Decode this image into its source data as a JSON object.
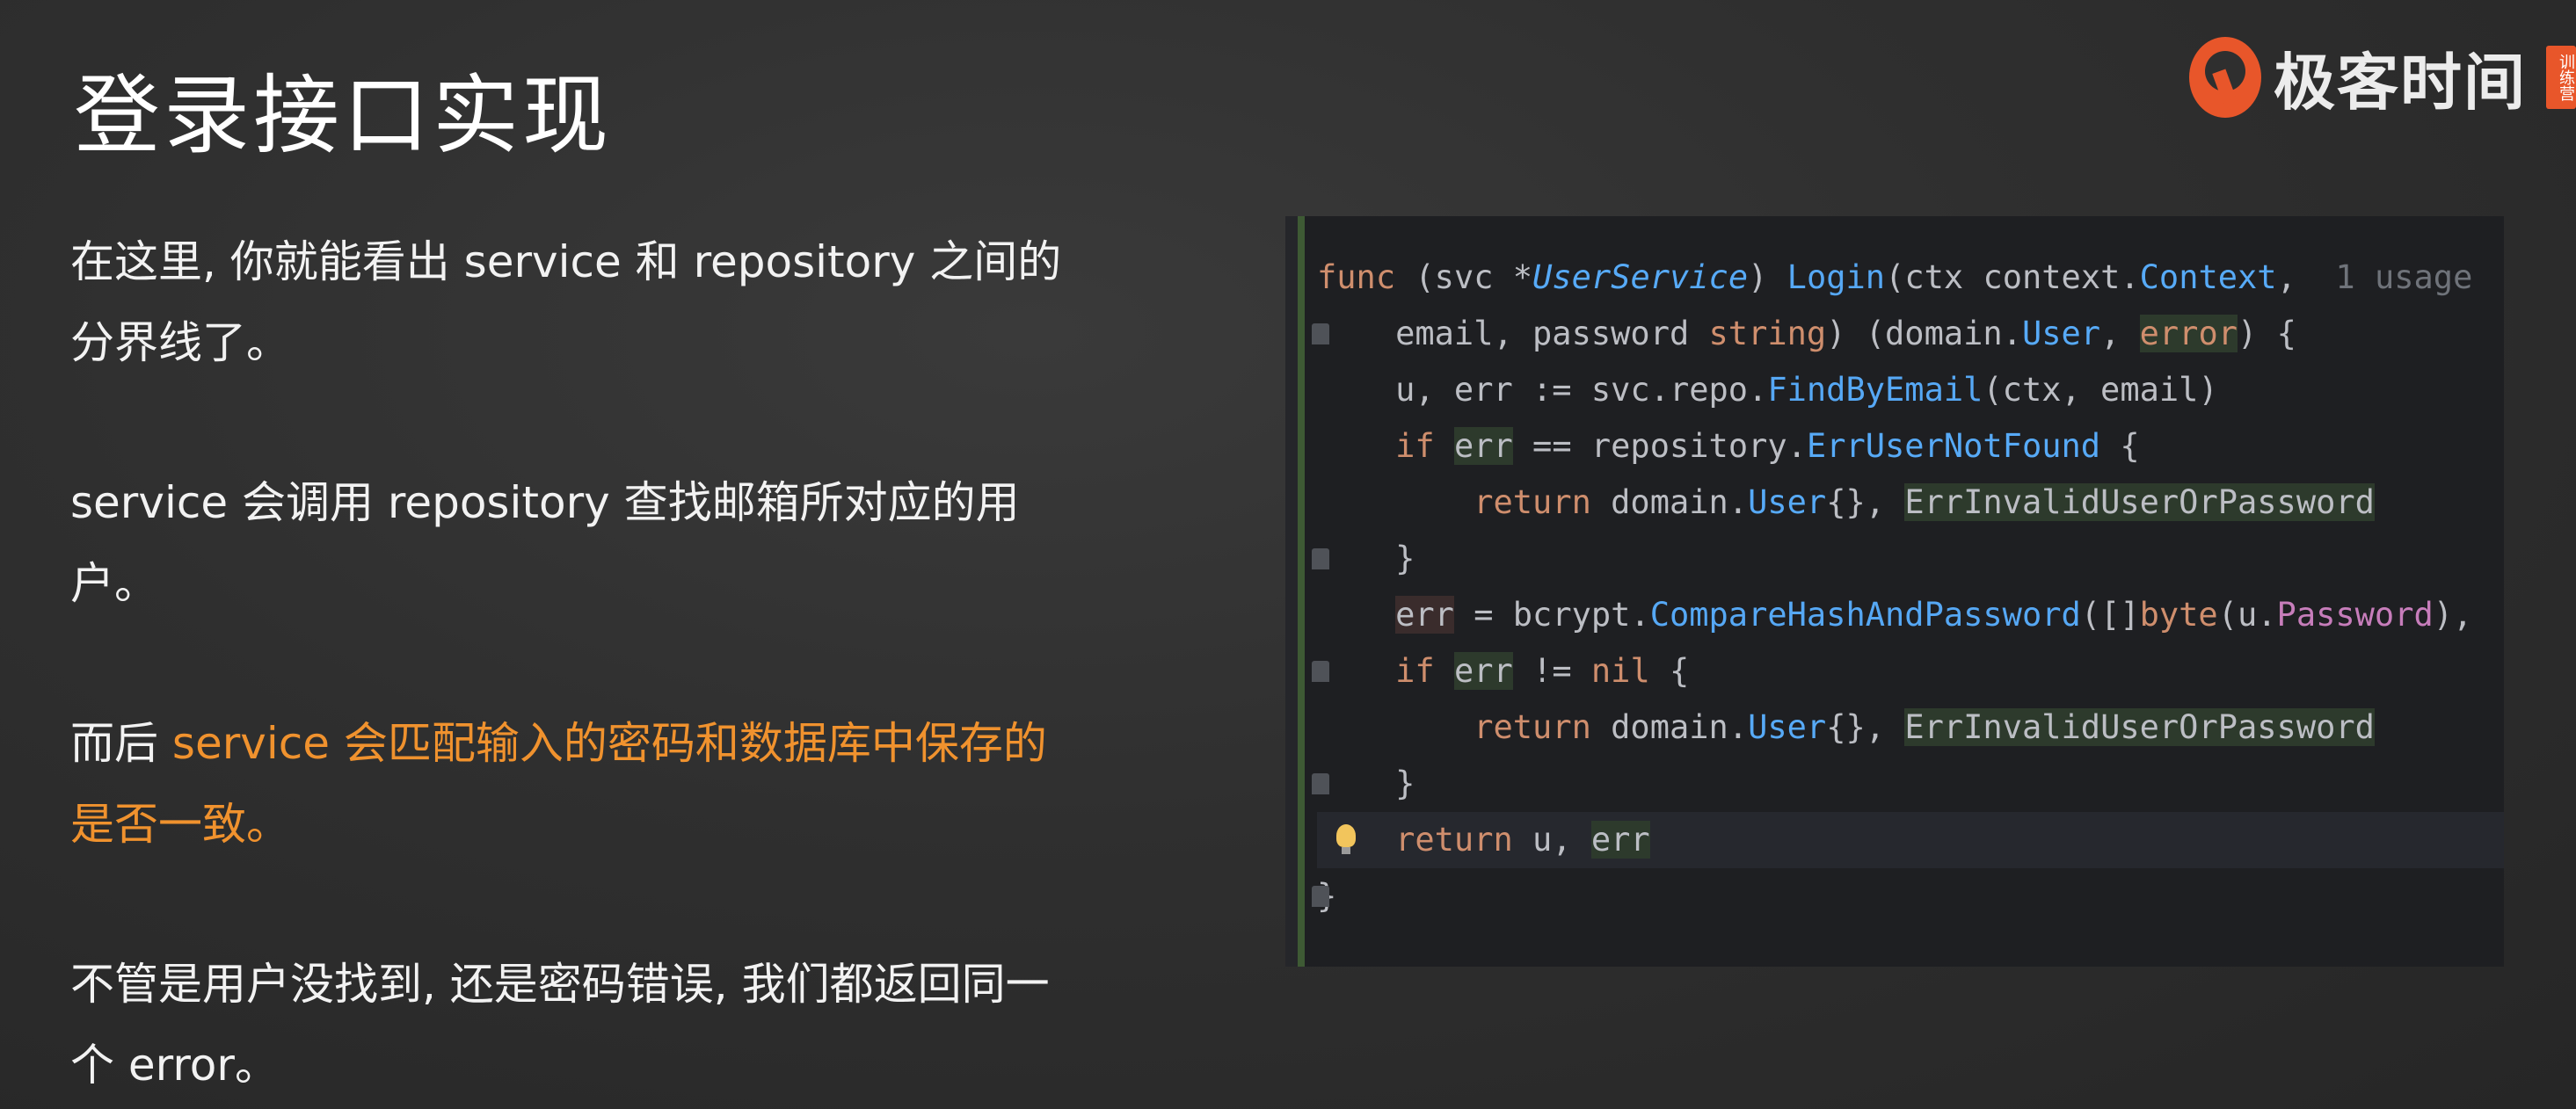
{
  "slide": {
    "title": "登录接口实现",
    "paragraphs": [
      {
        "text": "在这里, 你就能看出 service 和 repository 之间的分界线了。"
      },
      {
        "text": "service 会调用 repository 查找邮箱所对应的用户。"
      },
      {
        "prefix": "而后 ",
        "highlight": "service 会匹配输入的密码和数据库中保存的是否一致。"
      },
      {
        "text": "不管是用户没找到, 还是密码错误, 我们都返回同一个 error。"
      }
    ]
  },
  "brand": {
    "name": "极客时间",
    "tag": "训练营"
  },
  "code": {
    "usage_hint": "1 usage",
    "lines": [
      "func (svc *UserService) Login(ctx context.Context,",
      "    email, password string) (domain.User, error) {",
      "    u, err := svc.repo.FindByEmail(ctx, email)",
      "    if err == repository.ErrUserNotFound {",
      "        return domain.User{}, ErrInvalidUserOrPassword",
      "    }",
      "    err = bcrypt.CompareHashAndPassword([]byte(u.Password),",
      "    if err != nil {",
      "        return domain.User{}, ErrInvalidUserOrPassword",
      "    }",
      "    return u, err",
      "}"
    ]
  },
  "colors": {
    "highlight": "#f0922e",
    "keyword": "#cf8e6d",
    "function": "#56a8f5",
    "editor_bg": "#1e1f22",
    "brand": "#e8562a"
  }
}
